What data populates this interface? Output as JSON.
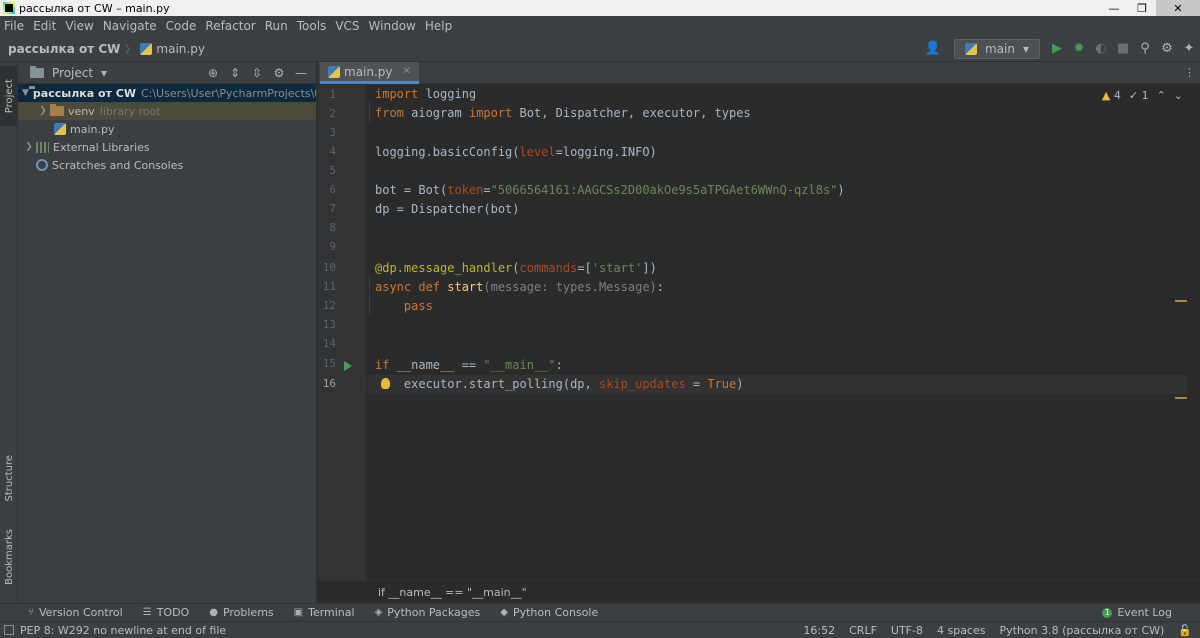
{
  "window": {
    "title": "рассылка от CW – main.py",
    "minimize": "—",
    "maximize": "❐",
    "close": "✕"
  },
  "menu": [
    "File",
    "Edit",
    "View",
    "Navigate",
    "Code",
    "Refactor",
    "Run",
    "Tools",
    "VCS",
    "Window",
    "Help"
  ],
  "navbar": {
    "project": "рассылка от CW",
    "separator": "〉",
    "file": "main.py",
    "run_config": "main"
  },
  "left_strip": {
    "project": "Project",
    "structure": "Structure",
    "bookmarks": "Bookmarks"
  },
  "project_panel": {
    "title": "Project",
    "tree": {
      "root_label": "рассылка от CW",
      "root_path": "C:\\Users\\User\\PycharmProjects\\боты\\",
      "venv_label": "venv",
      "venv_note": "library root",
      "file_label": "main.py",
      "ext_label": "External Libraries",
      "scratch_label": "Scratches and Consoles"
    }
  },
  "editor": {
    "tab_label": "main.py",
    "inspections": {
      "warnings": "4",
      "weak_warnings": "1"
    },
    "line_numbers": [
      "1",
      "2",
      "3",
      "4",
      "5",
      "6",
      "7",
      "8",
      "9",
      "10",
      "11",
      "12",
      "13",
      "14",
      "15",
      "16"
    ],
    "current_line": "16",
    "code": {
      "l1_kw": "import",
      "l1_rest": " logging",
      "l2_kw1": "from",
      "l2_mid": " aiogram ",
      "l2_kw2": "import",
      "l2_rest": " Bot, Dispatcher, executor, types",
      "l4_a": "logging.basicConfig(",
      "l4_p": "level",
      "l4_b": "=logging.INFO)",
      "l6_a": "bot = Bot(",
      "l6_p": "token",
      "l6_eq": "=",
      "l6_s": "\"5066564161:AAGCSs2D00akOe9s5aTPGAet6WWnQ-qzl8s\"",
      "l6_b": ")",
      "l7": "dp = Dispatcher(bot)",
      "l10_d": "@dp.message_handler",
      "l10_a": "(",
      "l10_p": "commands",
      "l10_b": "=[",
      "l10_s": "'start'",
      "l10_c": "])",
      "l11_kw": "async def ",
      "l11_fn": "start",
      "l11_hint": "(message: types.Message)",
      "l11_end": ":",
      "l12_kw": "    pass",
      "l15_kw": "if",
      "l15_a": " __name__ == ",
      "l15_s": "\"__main__\"",
      "l15_b": ":",
      "l16_a": "    executor.start_polling(dp, ",
      "l16_p": "skip_updates",
      "l16_b": " = ",
      "l16_kw": "True",
      "l16_c": ")"
    }
  },
  "breadcrumb": "if __name__ == \"__main__\"",
  "tool_windows": [
    "Version Control",
    "TODO",
    "Problems",
    "Terminal",
    "Python Packages",
    "Python Console"
  ],
  "event_log": "Event Log",
  "status": {
    "message": "PEP 8: W292 no newline at end of file",
    "position": "16:52",
    "line_sep": "CRLF",
    "encoding": "UTF-8",
    "indent": "4 spaces",
    "interpreter": "Python 3.8 (рассылка от CW)"
  }
}
